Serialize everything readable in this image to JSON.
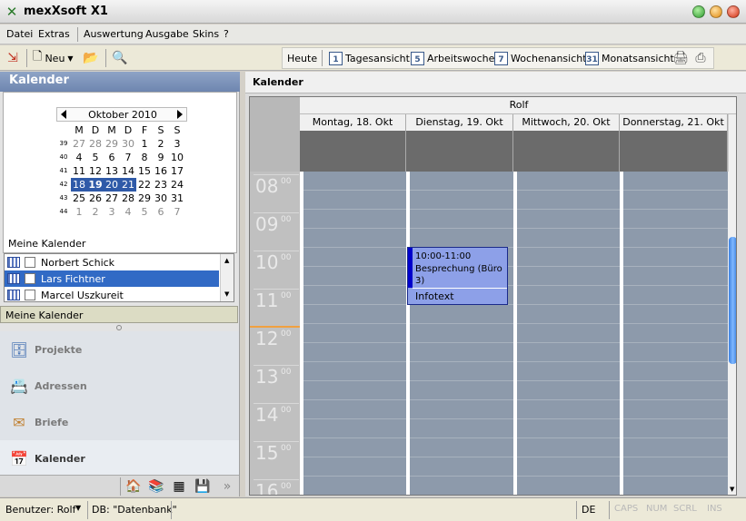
{
  "window": {
    "title": "mexXsoft X1"
  },
  "menu": [
    "Datei",
    "Extras",
    "Auswertung",
    "Ausgabe",
    "Skins",
    "?"
  ],
  "toolbar": {
    "new_label": "Neu",
    "today_label": "Heute",
    "views": [
      {
        "label": "Tagesansicht",
        "icon_text": "1"
      },
      {
        "label": "Arbeitswoche",
        "icon_text": "5"
      },
      {
        "label": "Wochenansicht",
        "icon_text": "7"
      },
      {
        "label": "Monatsansicht",
        "icon_text": "31"
      }
    ]
  },
  "left": {
    "header": "Kalender",
    "mini_calendar": {
      "month": "Oktober 2010",
      "weekday_headers": [
        "M",
        "D",
        "M",
        "D",
        "F",
        "S",
        "S"
      ],
      "weeks": [
        {
          "wk": "39",
          "days": [
            "27",
            "28",
            "29",
            "30",
            "1",
            "2",
            "3"
          ]
        },
        {
          "wk": "40",
          "days": [
            "4",
            "5",
            "6",
            "7",
            "8",
            "9",
            "10"
          ]
        },
        {
          "wk": "41",
          "days": [
            "11",
            "12",
            "13",
            "14",
            "15",
            "16",
            "17"
          ]
        },
        {
          "wk": "42",
          "days": [
            "18",
            "19",
            "20",
            "21",
            "22",
            "23",
            "24"
          ]
        },
        {
          "wk": "43",
          "days": [
            "25",
            "26",
            "27",
            "28",
            "29",
            "30",
            "31"
          ]
        },
        {
          "wk": "44",
          "days": [
            "1",
            "2",
            "3",
            "4",
            "5",
            "6",
            "7"
          ]
        }
      ]
    },
    "my_calendars_label": "Meine Kalender",
    "calendars": [
      "Norbert Schick",
      "Lars Fichtner",
      "Marcel Uszkureit"
    ],
    "group_bar": "Meine Kalender",
    "nav": [
      "Projekte",
      "Adressen",
      "Briefe",
      "Kalender"
    ]
  },
  "right": {
    "header": "Kalender",
    "person": "Rolf",
    "days": [
      "Montag, 18. Okt",
      "Dienstag, 19. Okt",
      "Mittwoch, 20. Okt",
      "Donnerstag, 21. Okt"
    ],
    "hours": [
      {
        "h": "08",
        "m": "00"
      },
      {
        "h": "09",
        "m": "00"
      },
      {
        "h": "10",
        "m": "00"
      },
      {
        "h": "11",
        "m": "00"
      },
      {
        "h": "12",
        "m": "00"
      },
      {
        "h": "13",
        "m": "00"
      },
      {
        "h": "14",
        "m": "00"
      },
      {
        "h": "15",
        "m": "00"
      },
      {
        "h": "16",
        "m": "00"
      }
    ],
    "event": {
      "time": "10:00-11:00",
      "title": "Besprechung (Büro 3)",
      "info": "Infotext"
    }
  },
  "status": {
    "user": "Benutzer: Rolf",
    "db": "DB: \"Datenbank\"",
    "lang": "DE",
    "keys": [
      "CAPS",
      "NUM",
      "SCRL",
      "INS"
    ]
  }
}
